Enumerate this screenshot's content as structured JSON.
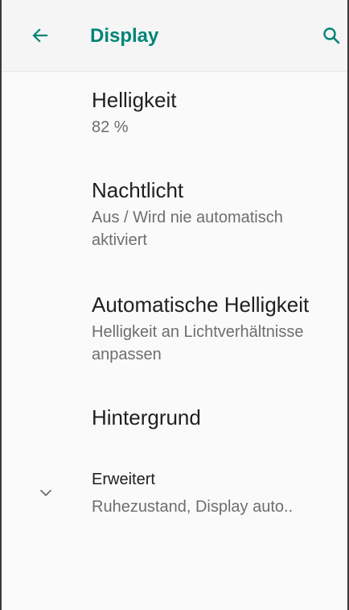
{
  "appbar": {
    "title": "Display",
    "back_icon": "arrow-left-icon",
    "search_icon": "search-icon",
    "accent_color": "#008577"
  },
  "settings": [
    {
      "title": "Helligkeit",
      "subtitle": "82 %"
    },
    {
      "title": "Nachtlicht",
      "subtitle": "Aus / Wird nie automatisch aktiviert"
    },
    {
      "title": "Automatische Helligkeit",
      "subtitle": "Helligkeit an Lichtverhältnisse anpassen"
    },
    {
      "title": "Hintergrund"
    }
  ],
  "advanced": {
    "title": "Erweitert",
    "subtitle": "Ruhezustand, Display auto..",
    "icon": "chevron-down-icon"
  }
}
